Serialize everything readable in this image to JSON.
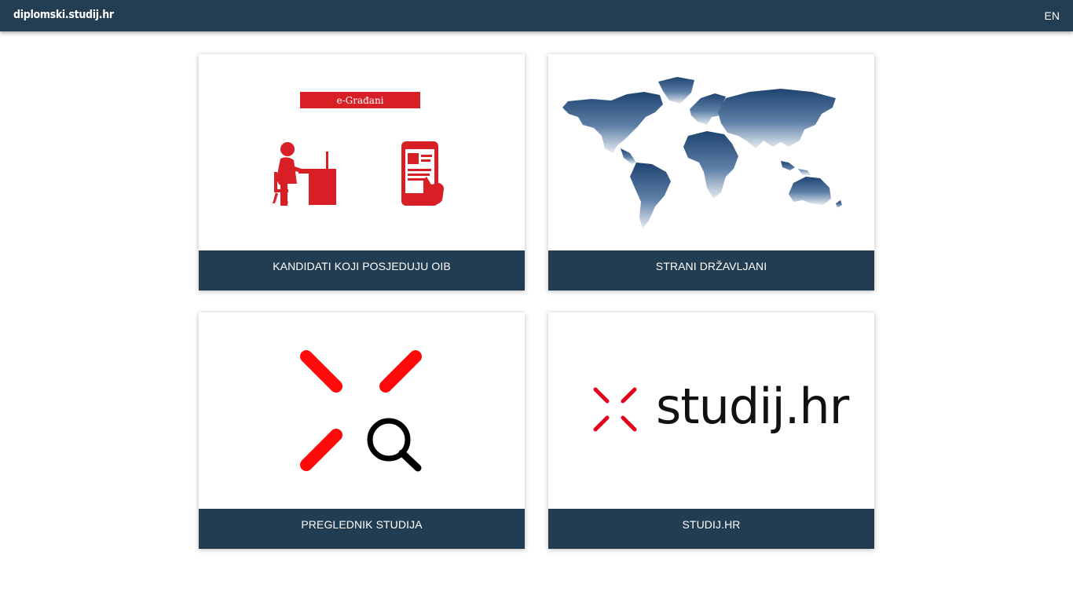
{
  "header": {
    "brand": "diplomski.studij.hr",
    "language_toggle": "EN"
  },
  "cards": [
    {
      "caption": "KANDIDATI KOJI POSJEDUJU OIB",
      "image_banner_text": "e-Građani",
      "icons": [
        "person-at-computer-icon",
        "smartphone-tap-icon"
      ]
    },
    {
      "caption": "STRANI DRŽAVLJANI",
      "icons": [
        "world-map-icon"
      ]
    },
    {
      "caption": "PREGLEDNIK STUDIJA",
      "icons": [
        "studij-logo-mark-icon",
        "magnifier-icon"
      ]
    },
    {
      "caption": "STUDIJ.HR",
      "logo_text": "studij.hr",
      "icons": [
        "studij-logo-mark-icon"
      ]
    }
  ],
  "colors": {
    "header_bg": "#233d52",
    "caption_bg": "#223c51",
    "brand_red": "#e3001b",
    "egradani_red": "#d91f26",
    "map_blue": "#2a4f7c"
  }
}
